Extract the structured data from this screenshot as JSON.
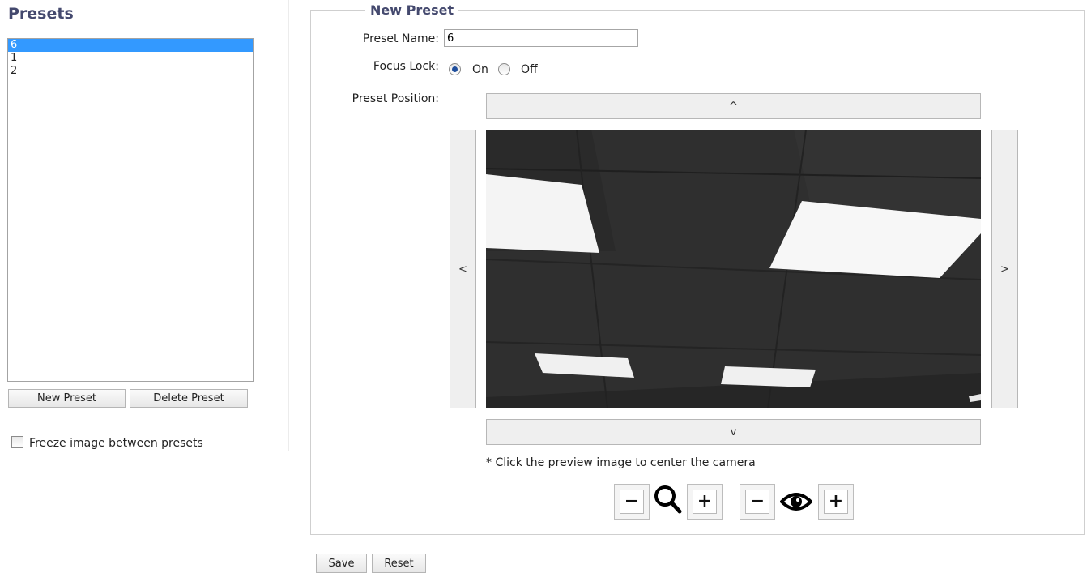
{
  "presets_panel": {
    "title": "Presets",
    "items": [
      "6",
      "1",
      "2"
    ],
    "selected_index": 0,
    "new_button": "New Preset",
    "delete_button": "Delete Preset",
    "freeze_label": "Freeze image between presets",
    "freeze_checked": false
  },
  "form": {
    "legend": "New Preset",
    "preset_name_label": "Preset Name:",
    "preset_name_value": "6",
    "focus_lock_label": "Focus Lock:",
    "focus_lock_on": "On",
    "focus_lock_off": "Off",
    "focus_lock_selected": "On",
    "preset_position_label": "Preset Position:",
    "pan_up": "^",
    "pan_down": "v",
    "pan_left": "<",
    "pan_right": ">",
    "preview_note": "* Click the preview image to center the camera",
    "zoom_out": "−",
    "zoom_in": "+",
    "focus_out": "−",
    "focus_in": "+"
  },
  "icons": {
    "zoom": "magnifier-icon",
    "focus": "eye-icon"
  },
  "footer": {
    "save": "Save",
    "reset": "Reset"
  },
  "colors": {
    "heading": "#44496e",
    "selection": "#3399ff"
  }
}
